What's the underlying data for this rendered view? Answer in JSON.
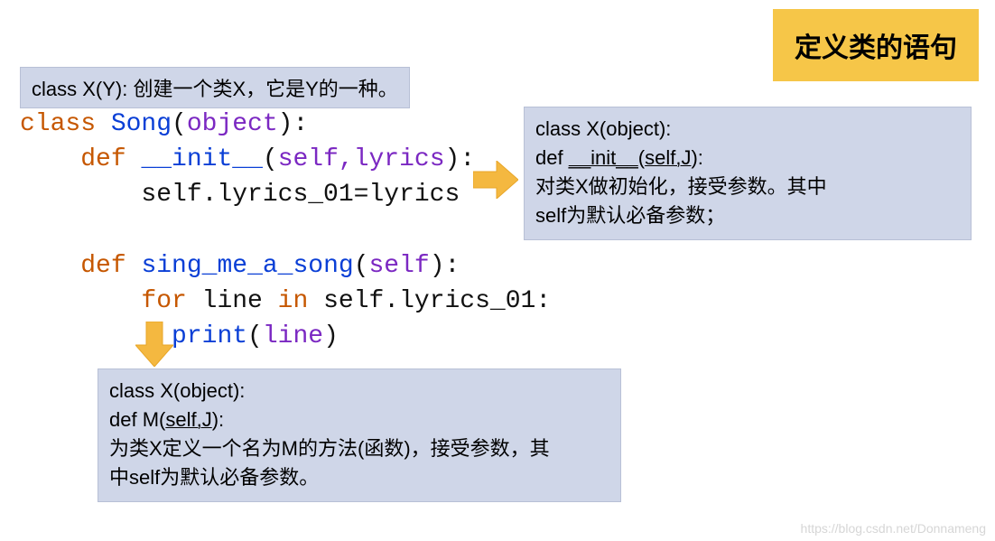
{
  "title": "定义类的语句",
  "annot_top": "class X(Y): 创建一个类X，它是Y的一种。",
  "code": {
    "kw_class": "class",
    "class_name": " Song",
    "paren_open": "(",
    "object": "object",
    "paren_close_colon": "):",
    "kw_def1": "def",
    "init_name": " __init__",
    "init_args_open": "(",
    "init_args": "self,lyrics",
    "init_args_close": "):",
    "init_body": "self.lyrics_01=lyrics",
    "kw_def2": "def",
    "method_name": " sing_me_a_song",
    "method_args_open": "(",
    "method_args": "self",
    "method_args_close": "):",
    "for_kw": "for",
    "for_var": " line ",
    "in_kw": "in",
    "for_iter": " self.lyrics_01:",
    "print_fn": "print",
    "print_open": "(",
    "print_arg": "line",
    "print_close": ")"
  },
  "annot_right": {
    "line1": "class X(object):",
    "line2_pre": "   def ",
    "line2_u": "__init__",
    "line2_mid": "(",
    "line2_args": "self,J",
    "line2_post": "):",
    "line3": "对类X做初始化，接受参数。其中",
    "line4_self": "self",
    "line4_rest": "为默认必备参数；"
  },
  "annot_bottom": {
    "line1": "class X(object):",
    "line2_pre": "  def M(",
    "line2_args": "self,J",
    "line2_post": "):",
    "line3": "为类X定义一个名为M的方法(函数)，接受参数，其",
    "line4_pre": "中",
    "line4_self": "self",
    "line4_rest": "为默认必备参数。"
  },
  "watermark": "https://blog.csdn.net/Donnameng",
  "colors": {
    "title_bg": "#f6c648",
    "annot_bg": "#cfd6e8",
    "arrow": "#f4b840"
  }
}
